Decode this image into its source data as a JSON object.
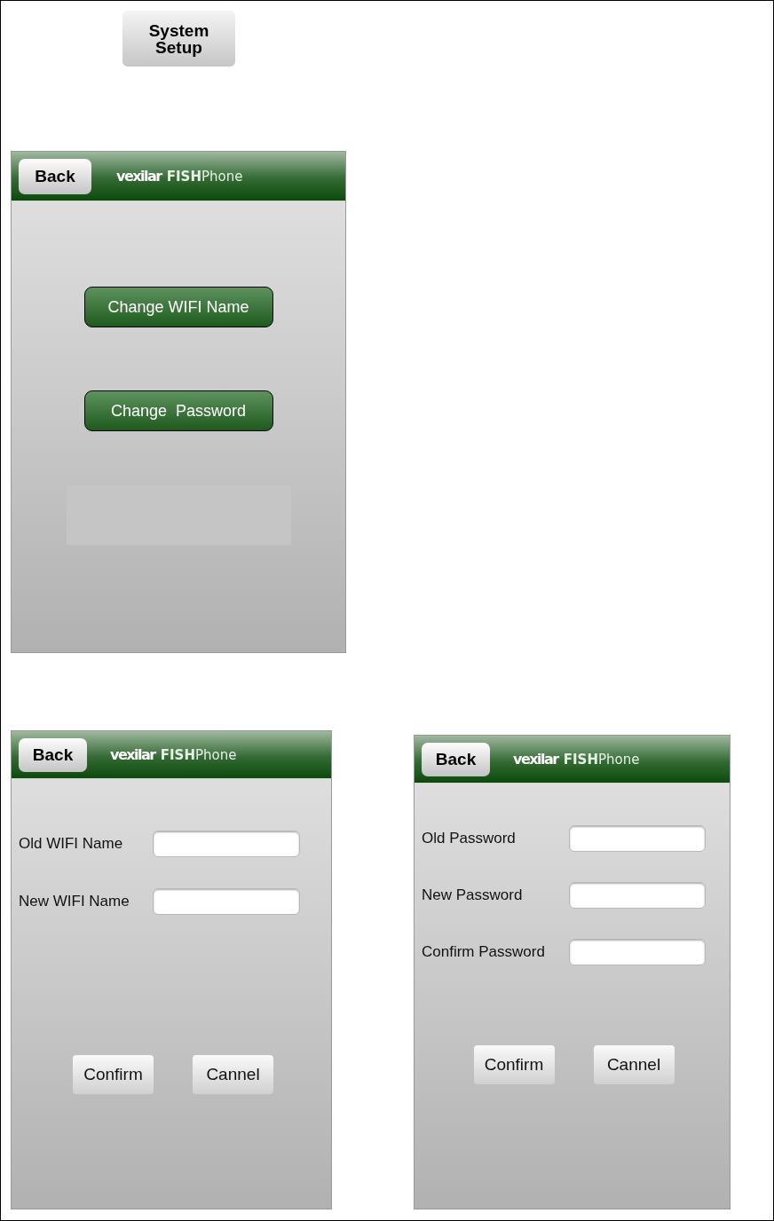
{
  "top_button": "System Setup",
  "screens": [
    {
      "kind": "menu",
      "back": "Back",
      "brand": {
        "name": "vexilar",
        "product": "**FISH**Phone"
      },
      "buttons": [
        "Change WIFI Name",
        "Change  Password"
      ]
    },
    {
      "kind": "form",
      "back": "Back",
      "brand": {
        "name": "vexilar",
        "product": "**FISH**Phone"
      },
      "fields": [
        {
          "label": "Old WIFI Name"
        },
        {
          "label": "New WIFI Name"
        }
      ],
      "actions": [
        "Confirm",
        "Cannel"
      ]
    },
    {
      "kind": "form",
      "back": "Back",
      "brand": {
        "name": "vexilar",
        "product": "**FISH**Phone"
      },
      "fields": [
        {
          "label": "Old Password"
        },
        {
          "label": "New Password"
        },
        {
          "label": "Confirm Password"
        }
      ],
      "actions": [
        "Confirm",
        "Cannel"
      ]
    }
  ]
}
